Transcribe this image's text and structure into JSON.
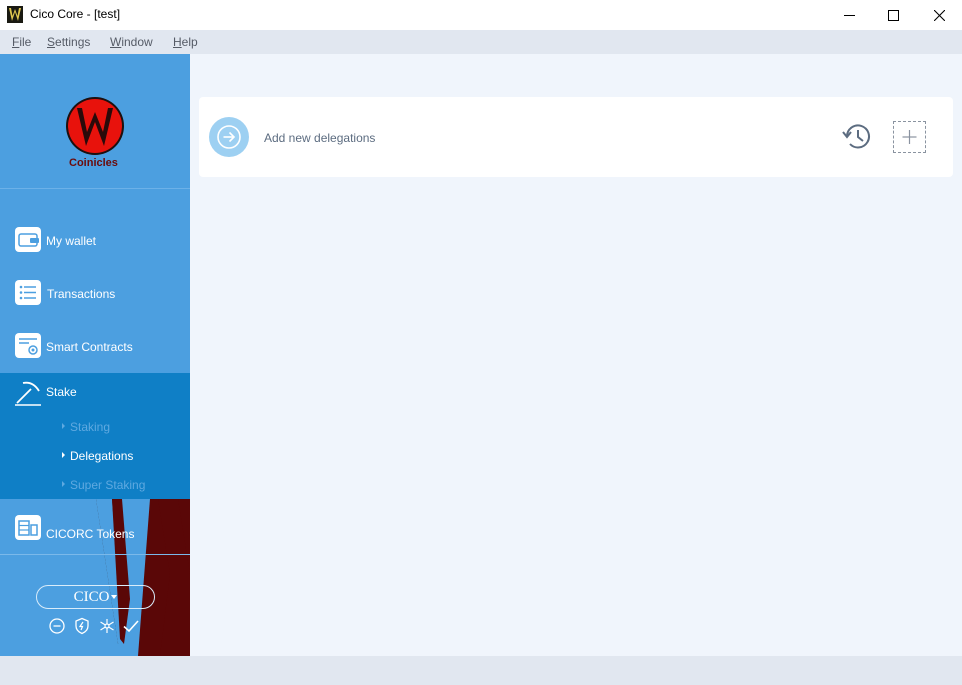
{
  "window": {
    "title": "Cico Core - [test]"
  },
  "menu": [
    {
      "accel": "F",
      "rest": "ile"
    },
    {
      "accel": "S",
      "rest": "ettings"
    },
    {
      "accel": "W",
      "rest": "indow"
    },
    {
      "accel": "H",
      "rest": "elp"
    }
  ],
  "sidebar": {
    "logo_text": "Coinicles",
    "items": {
      "wallet": "My wallet",
      "transactions": "Transactions",
      "contracts": "Smart Contracts",
      "stake": "Stake",
      "tokens": "CICORC Tokens"
    },
    "stake_sub": {
      "staking": "Staking",
      "delegations": "Delegations",
      "super_staking": "Super Staking"
    },
    "unit": "CICO",
    "status_icons": [
      "minus-circle-icon",
      "shield-icon",
      "network-icon",
      "checkmark-icon"
    ]
  },
  "main": {
    "add_label": "Add new delegations"
  },
  "colors": {
    "sidebar": "#4c9fe0",
    "stake_active": "#0f7fc6",
    "main_bg": "#f0f5fc",
    "accent_circle": "#9dd0f2",
    "logo_red": "#e8120c"
  }
}
